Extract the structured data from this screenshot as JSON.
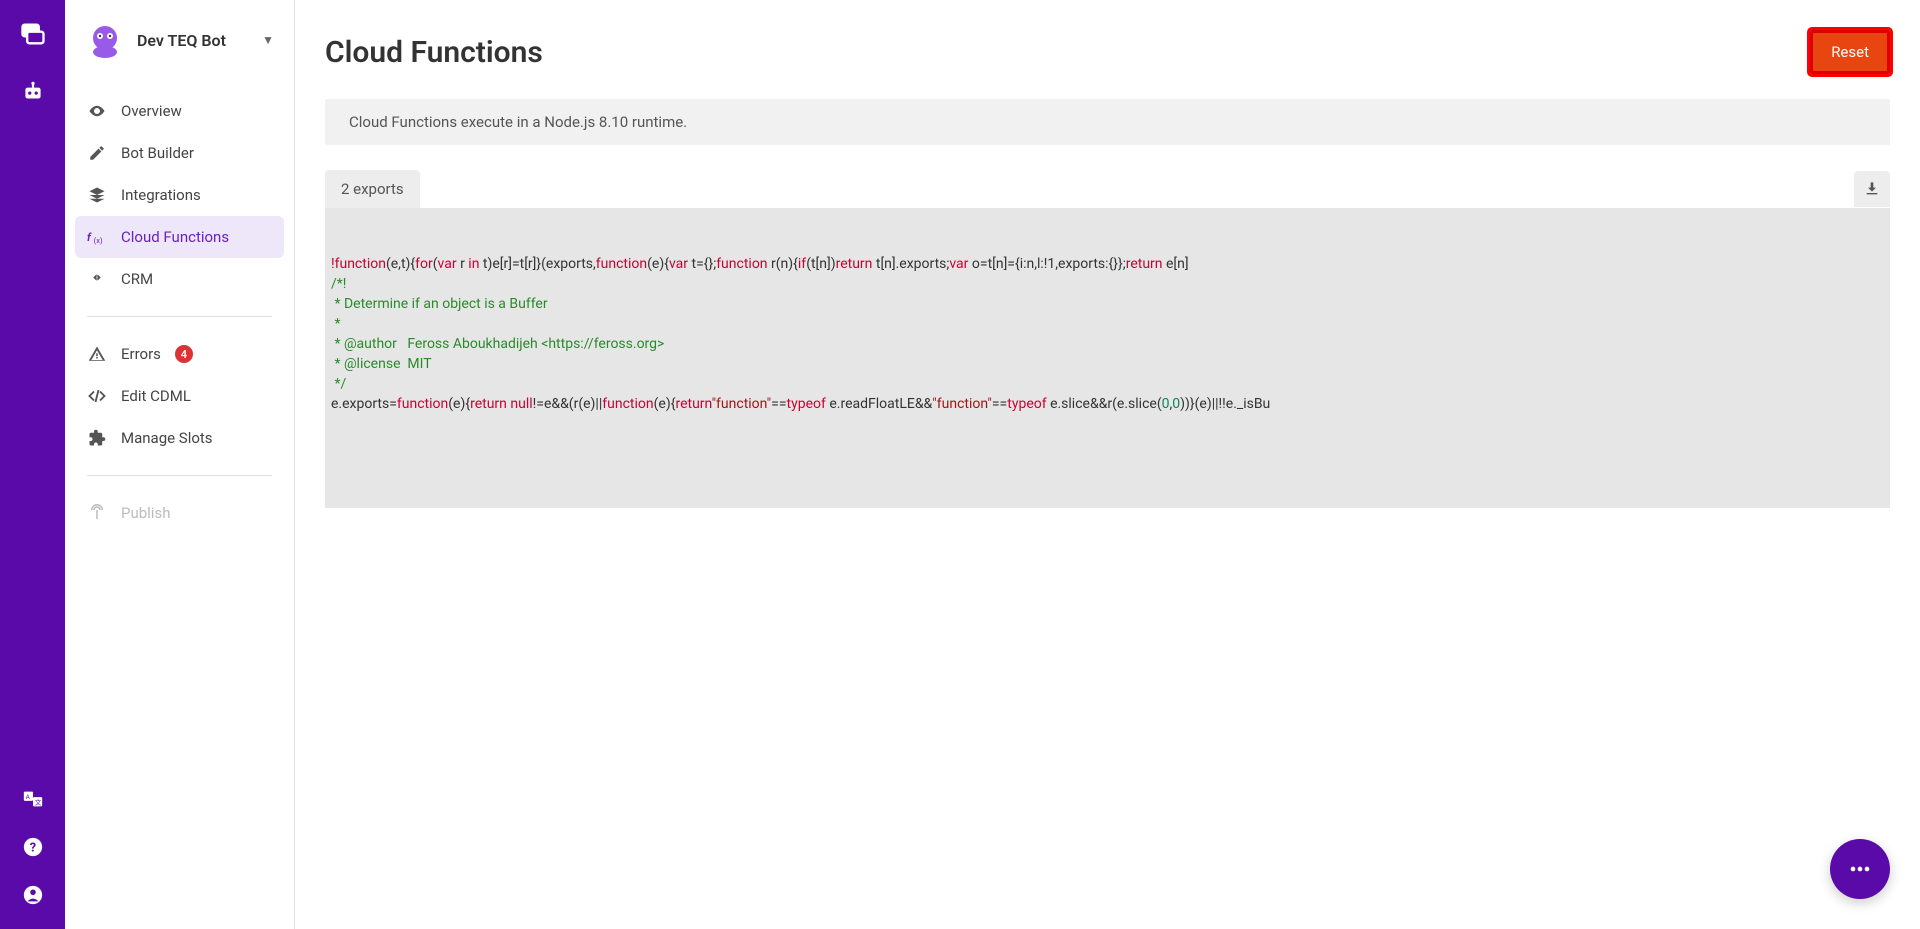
{
  "rail": {
    "top_icons": [
      "chat-bubbles-icon",
      "robot-icon"
    ],
    "bottom_icons": [
      "translate-icon",
      "help-icon",
      "account-icon"
    ]
  },
  "botHeader": {
    "name": "Dev TEQ Bot"
  },
  "nav": {
    "items": [
      {
        "icon": "eye-icon",
        "label": "Overview"
      },
      {
        "icon": "pencil-icon",
        "label": "Bot Builder"
      },
      {
        "icon": "layers-icon",
        "label": "Integrations"
      },
      {
        "icon": "fx-icon",
        "label": "Cloud Functions",
        "active": true
      },
      {
        "icon": "handshake-icon",
        "label": "CRM"
      }
    ],
    "items2": [
      {
        "icon": "warning-icon",
        "label": "Errors",
        "badge": "4"
      },
      {
        "icon": "code-icon",
        "label": "Edit CDML"
      },
      {
        "icon": "puzzle-icon",
        "label": "Manage Slots"
      }
    ],
    "items3": [
      {
        "icon": "antenna-icon",
        "label": "Publish",
        "disabled": true
      }
    ]
  },
  "page": {
    "title": "Cloud Functions",
    "reset": "Reset",
    "info": "Cloud Functions execute in a Node.js 8.10 runtime.",
    "exports": "2 exports"
  },
  "code": {
    "line1": {
      "p1": "!",
      "p2": "function",
      "p3": "(e,t){",
      "p4": "for",
      "p5": "(",
      "p6": "var",
      "p7": " r ",
      "p8": "in",
      "p9": " t)e[r]=t[r]}(exports,",
      "p10": "function",
      "p11": "(e){",
      "p12": "var",
      "p13": " t={};",
      "p14": "function",
      "p15": " r(n){",
      "p16": "if",
      "p17": "(t[n])",
      "p18": "return",
      "p19": " t[n].exports;",
      "p20": "var",
      "p21": " o=t[n]={i:n,l:!1,exports:{}};",
      "p22": "return",
      "p23": " e[n]"
    },
    "comment": "/*!\n * Determine if an object is a Buffer\n *\n * @author   Feross Aboukhadijeh <https://feross.org>\n * @license  MIT\n */",
    "line7": {
      "p1": "e.exports=",
      "p2": "function",
      "p3": "(e){",
      "p4": "return",
      "p5": " ",
      "p6": "null",
      "p7": "!=e&&(r(e)||",
      "p8": "function",
      "p9": "(e){",
      "p10": "return",
      "p11": "\"function\"",
      "p12": "==",
      "p13": "typeof",
      "p14": " e.readFloatLE&&",
      "p15": "\"function\"",
      "p16": "==",
      "p17": "typeof",
      "p18": " e.slice&&r(e.slice(",
      "p19": "0",
      "p20": ",",
      "p21": "0",
      "p22": "))}(e)||!!e._isBu"
    }
  }
}
